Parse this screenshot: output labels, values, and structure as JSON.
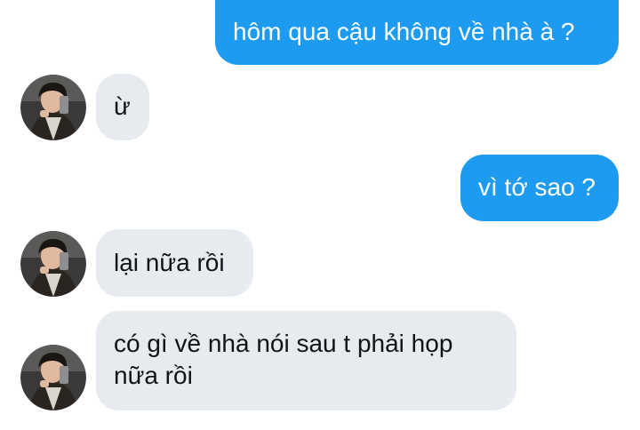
{
  "messages": [
    {
      "direction": "outgoing",
      "text": "hôm qua cậu không về nhà à ?"
    },
    {
      "direction": "incoming",
      "text": "ừ"
    },
    {
      "direction": "outgoing",
      "text": "vì tớ sao ?"
    },
    {
      "direction": "incoming",
      "text": "lại nữa rồi"
    },
    {
      "direction": "incoming",
      "text_lines": [
        "có gì về nhà nói sau t phải họp",
        "nữa rồi"
      ]
    }
  ],
  "colors": {
    "outgoing_bubble": "#1d9bf0",
    "incoming_bubble": "#e7ebef",
    "outgoing_text": "#ffffff",
    "incoming_text": "#0f1419"
  }
}
